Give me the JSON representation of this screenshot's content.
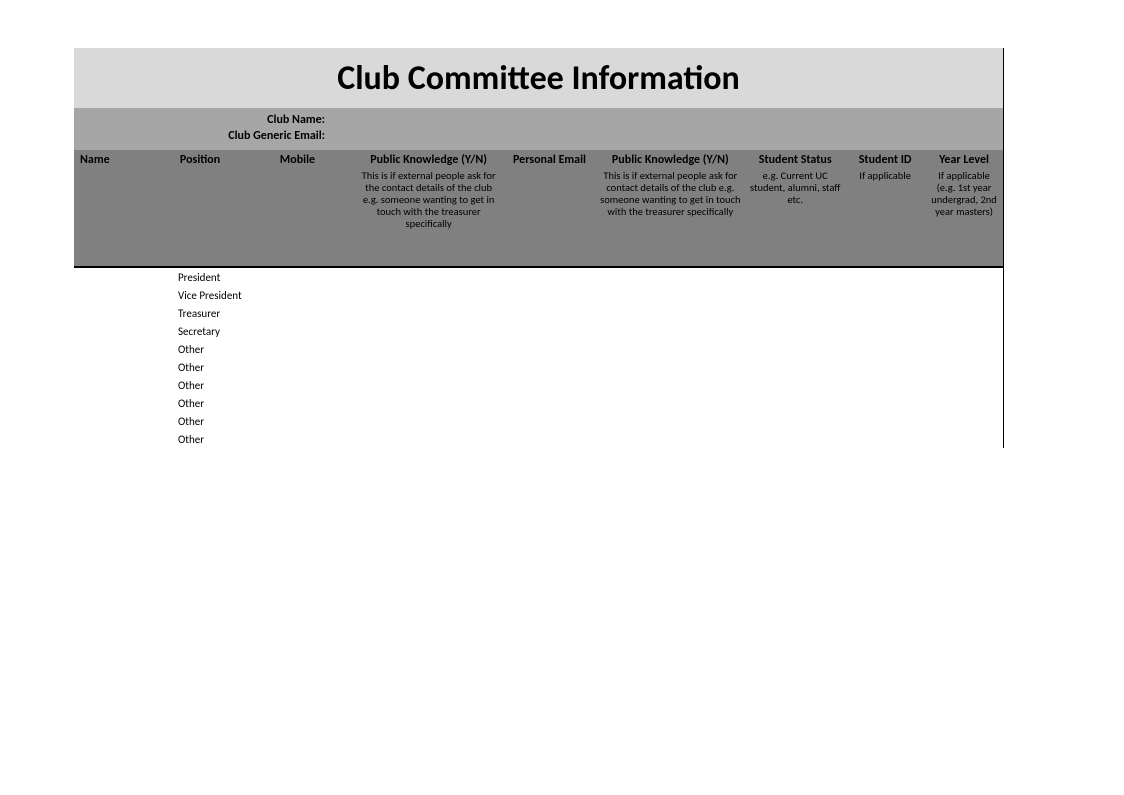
{
  "title": "Club Committee Information",
  "meta": {
    "club_name_label": "Club Name:",
    "club_name_value": "",
    "club_email_label": "Club Generic Email:",
    "club_email_value": ""
  },
  "headers": {
    "name": {
      "label": "Name",
      "desc": ""
    },
    "pos": {
      "label": "Position",
      "desc": ""
    },
    "mobile": {
      "label": "Mobile",
      "desc": ""
    },
    "pk1": {
      "label": "Public Knowledge (Y/N)",
      "desc": "This is if external people ask for the contact details of the club e.g. someone wanting to get in touch with the treasurer specifically"
    },
    "email": {
      "label": "Personal Email",
      "desc": ""
    },
    "pk2": {
      "label": "Public Knowledge (Y/N)",
      "desc": "This is if external people ask for contact details of the club e.g. someone wanting to get in touch with the treasurer specifically"
    },
    "status": {
      "label": "Student Status",
      "desc": "e.g. Current UC student, alumni, staff etc."
    },
    "sid": {
      "label": "Student ID",
      "desc": "If applicable"
    },
    "year": {
      "label": "Year Level",
      "desc": "If applicable (e.g. 1st year undergrad, 2nd year masters)"
    }
  },
  "rows": [
    {
      "name": "",
      "position": "President"
    },
    {
      "name": "",
      "position": "Vice President"
    },
    {
      "name": "",
      "position": "Treasurer"
    },
    {
      "name": "",
      "position": "Secretary"
    },
    {
      "name": "",
      "position": "Other"
    },
    {
      "name": "",
      "position": "Other"
    },
    {
      "name": "",
      "position": "Other"
    },
    {
      "name": "",
      "position": "Other"
    },
    {
      "name": "",
      "position": "Other"
    },
    {
      "name": "",
      "position": "Other"
    }
  ]
}
